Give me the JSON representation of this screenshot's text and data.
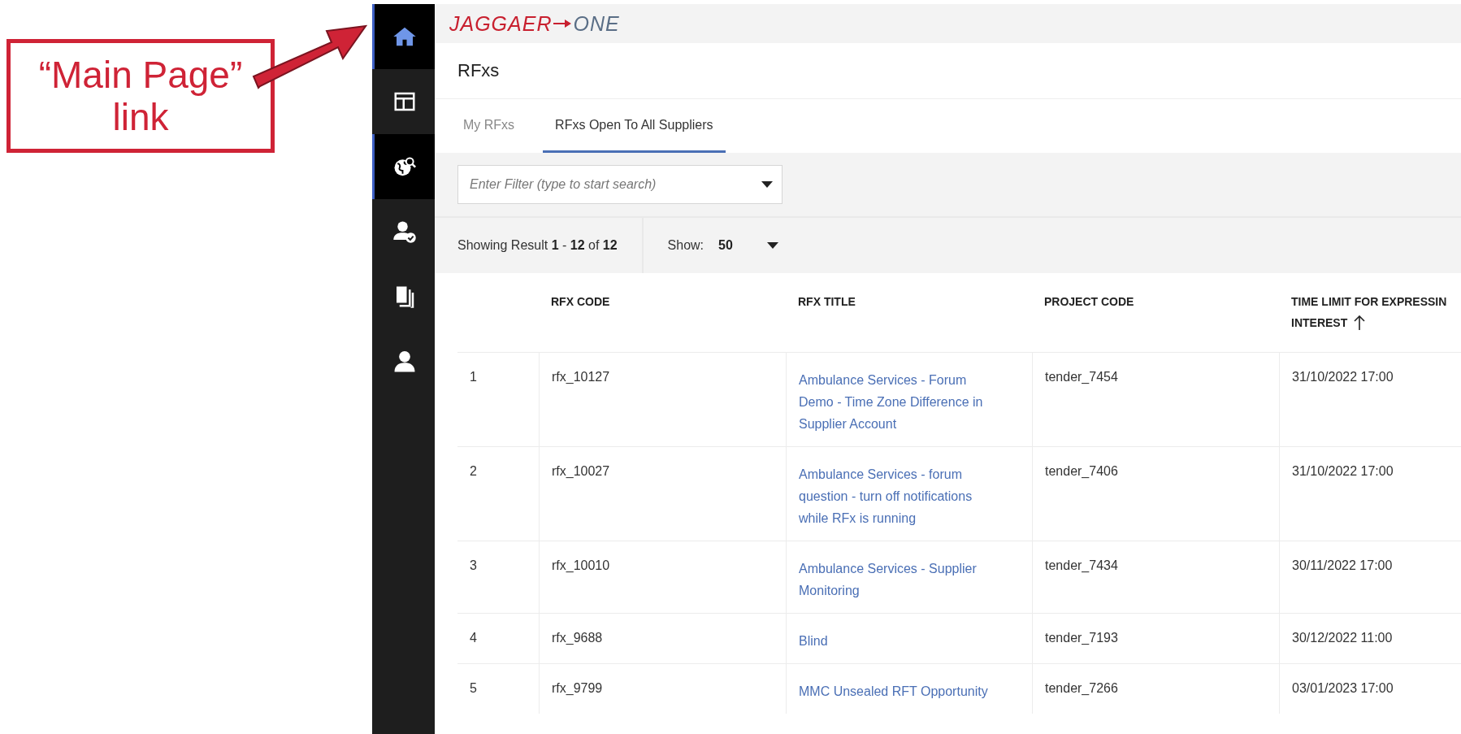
{
  "callout": {
    "text": "“Main Page” link"
  },
  "logo": {
    "brand": "JAGGAER",
    "suffix": "ONE"
  },
  "sidebar": {
    "items": [
      {
        "selected": true,
        "highlighted": true
      },
      {
        "selected": false,
        "highlighted": false
      },
      {
        "selected": true,
        "highlighted": false
      },
      {
        "selected": false,
        "highlighted": false
      },
      {
        "selected": false,
        "highlighted": false
      },
      {
        "selected": false,
        "highlighted": false
      }
    ]
  },
  "page": {
    "title": "RFxs"
  },
  "tabs": [
    {
      "label": "My RFxs",
      "selected": false
    },
    {
      "label": "RFxs Open To All Suppliers",
      "selected": true
    }
  ],
  "filter": {
    "placeholder": "Enter Filter (type to start search)"
  },
  "results": {
    "summary": "Showing Result **1** - **12** of **12**",
    "show_label": "Show:",
    "show_value": "50"
  },
  "table": {
    "columns": [
      {
        "lines": [
          "RFX CODE"
        ],
        "sorted": false
      },
      {
        "lines": [
          "RFX TITLE"
        ],
        "sorted": false
      },
      {
        "lines": [
          "PROJECT CODE"
        ],
        "sorted": false
      },
      {
        "lines": [
          "TIME LIMIT FOR EXPRESSIN",
          "INTEREST"
        ],
        "sorted": true
      }
    ],
    "rows": [
      {
        "number": "1",
        "rfx_code": "rfx_10127",
        "title": "Ambulance Services - Forum Demo - Time Zone Difference in Supplier Account",
        "project_code": "tender_7454",
        "time_limit": "31/10/2022 17:00"
      },
      {
        "number": "2",
        "rfx_code": "rfx_10027",
        "title": "Ambulance Services - forum question - turn off notifications while RFx is running",
        "project_code": "tender_7406",
        "time_limit": "31/10/2022 17:00"
      },
      {
        "number": "3",
        "rfx_code": "rfx_10010",
        "title": "Ambulance Services - Supplier Monitoring",
        "project_code": "tender_7434",
        "time_limit": "30/11/2022 17:00"
      },
      {
        "number": "4",
        "rfx_code": "rfx_9688",
        "title": "Blind",
        "project_code": "tender_7193",
        "time_limit": "30/12/2022 11:00"
      },
      {
        "number": "5",
        "rfx_code": "rfx_9799",
        "title": "MMC Unsealed RFT Opportunity",
        "project_code": "tender_7266",
        "time_limit": "03/01/2023 17:00"
      }
    ]
  }
}
